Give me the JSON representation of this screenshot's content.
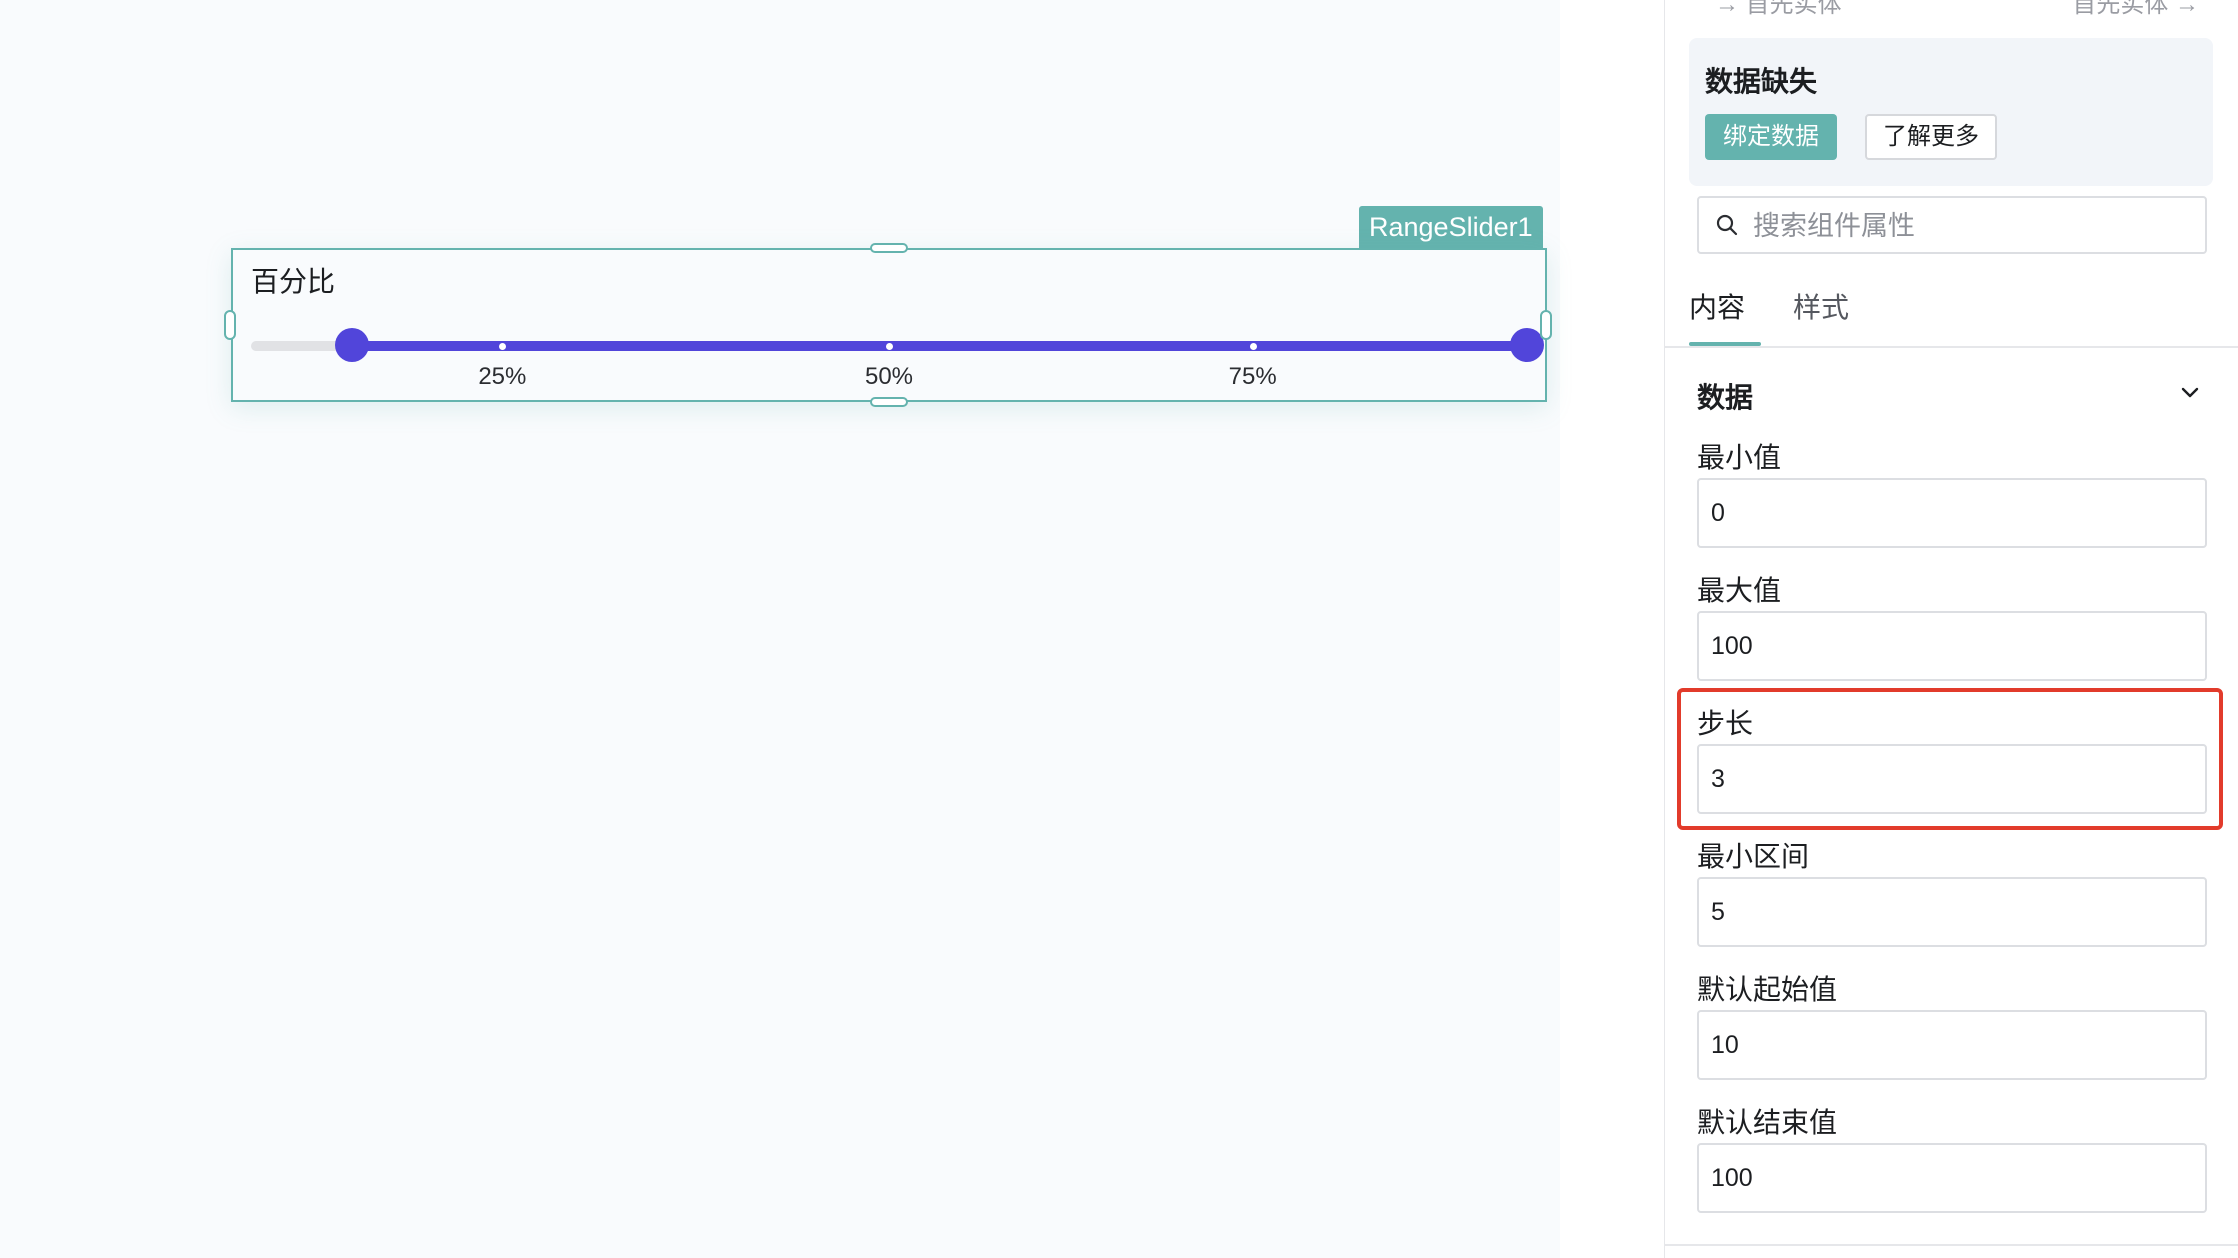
{
  "canvas": {
    "widget_name": "RangeSlider1",
    "slider": {
      "title": "百分比",
      "min": 0,
      "max": 100,
      "start": 10,
      "end": 100,
      "ticks": [
        {
          "value": 25,
          "label": "25%"
        },
        {
          "value": 50,
          "label": "50%"
        },
        {
          "value": 75,
          "label": "75%"
        }
      ],
      "colors": {
        "accent": "#5145da",
        "track": "#e1e2e5",
        "selection": "#64b3ae"
      }
    }
  },
  "panel": {
    "top_links": {
      "left": "→ 首先实体",
      "right": "首先实体 →"
    },
    "missing_data": {
      "title": "数据缺失",
      "bind_button": "绑定数据",
      "learn_more_button": "了解更多"
    },
    "search": {
      "placeholder": "搜索组件属性",
      "value": "",
      "icon": "search-icon"
    },
    "tabs": [
      {
        "label": "内容",
        "active": true
      },
      {
        "label": "样式",
        "active": false
      }
    ],
    "section": {
      "title": "数据",
      "icon": "chevron-down-icon"
    },
    "fields": [
      {
        "label": "最小值",
        "value": "0"
      },
      {
        "label": "最大值",
        "value": "100"
      },
      {
        "label": "步长",
        "value": "3",
        "highlighted": true
      },
      {
        "label": "最小区间",
        "value": "5"
      },
      {
        "label": "默认起始值",
        "value": "10"
      },
      {
        "label": "默认结束值",
        "value": "100"
      }
    ],
    "highlight_color": "#e23b2b"
  }
}
